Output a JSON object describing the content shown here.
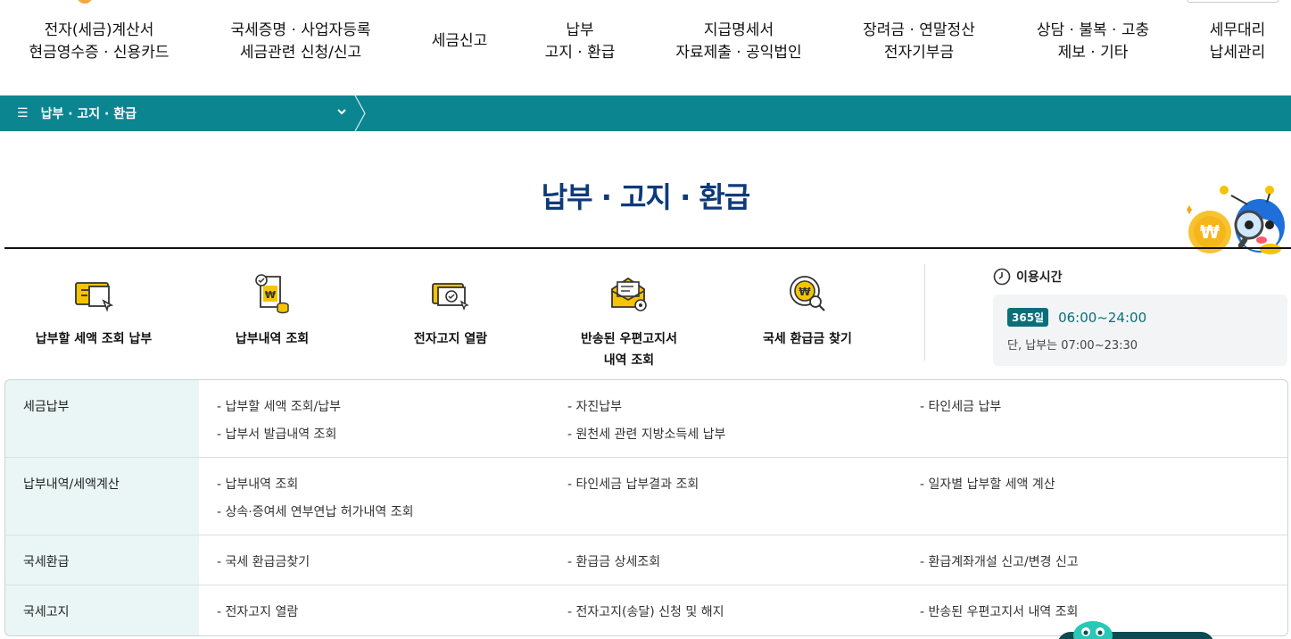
{
  "gnb": [
    {
      "line1": "전자(세금)계산서",
      "line2": "현금영수증 · 신용카드"
    },
    {
      "line1": "국세증명 · 사업자등록",
      "line2": "세금관련 신청/신고"
    },
    {
      "line1": "세금신고",
      "line2": ""
    },
    {
      "line1": "납부",
      "line2": "고지 · 환급"
    },
    {
      "line1": "지급명세서",
      "line2": "자료제출 · 공익법인"
    },
    {
      "line1": "장려금 · 연말정산",
      "line2": "전자기부금"
    },
    {
      "line1": "상담 · 불복 · 고충",
      "line2": "제보 · 기타"
    },
    {
      "line1": "세무대리",
      "line2": "납세관리"
    }
  ],
  "location": {
    "label": "납부 · 고지 · 환급"
  },
  "page": {
    "title": "납부 · 고지 · 환급"
  },
  "quick": [
    {
      "line1": "납부할 세액 조회 납부",
      "line2": "",
      "icon": "tax-bill-icon"
    },
    {
      "line1": "납부내역 조회",
      "line2": "",
      "icon": "payment-history-icon"
    },
    {
      "line1": "전자고지 열람",
      "line2": "",
      "icon": "e-notice-icon"
    },
    {
      "line1": "반송된 우편고지서",
      "line2": "내역 조회",
      "icon": "returned-mail-icon"
    },
    {
      "line1": "국세 환급금 찾기",
      "line2": "",
      "icon": "refund-search-icon"
    }
  ],
  "hours": {
    "title": "이용시간",
    "badge": "365일",
    "time": "06:00~24:00",
    "note": "단, 납부는 07:00~23:30"
  },
  "table": [
    {
      "head": "세금납부",
      "links": [
        "- 납부할 세액 조회/납부",
        "- 자진납부",
        "- 타인세금 납부",
        "- 납부서 발급내역 조회",
        "- 원천세 관련 지방소득세 납부"
      ]
    },
    {
      "head": "납부내역/세액계산",
      "links": [
        "- 납부내역 조회",
        "- 타인세금 납부결과 조회",
        "- 일자별 납부할 세액 계산",
        "- 상속·증여세 연부연납 허가내역 조회"
      ]
    },
    {
      "head": "국세환급",
      "links": [
        "- 국세 환급금찾기",
        "- 환급금 상세조회",
        "- 환급계좌개설 신고/변경 신고"
      ]
    },
    {
      "head": "국세고지",
      "links": [
        "- 전자고지 열람",
        "- 전자고지(송달) 신청 및 해지",
        "- 반송된 우편고지서 내역 조회"
      ]
    }
  ],
  "colors": {
    "teal": "#0b8691",
    "navy": "#0d3a7a",
    "accent": "#f5c400"
  }
}
